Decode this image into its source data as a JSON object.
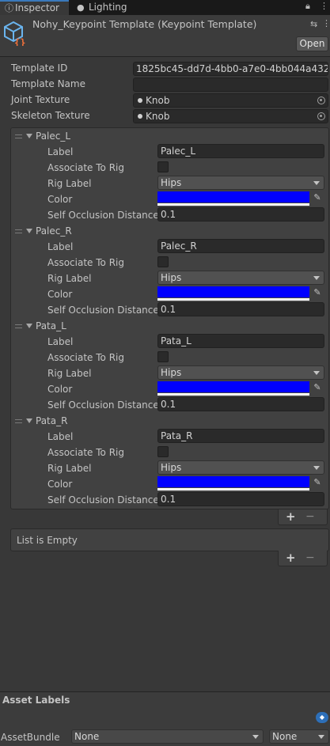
{
  "tabs": {
    "inspector": {
      "label": "Inspector",
      "icon": "info-icon"
    },
    "lighting": {
      "label": "Lighting",
      "icon": "lightbulb-icon"
    }
  },
  "header": {
    "title": "Nohy_Keypoint Template (Keypoint Template)",
    "icon": "scriptable-object-icon",
    "open_label": "Open"
  },
  "fields": {
    "template_id": {
      "label": "Template ID",
      "value": "1825bc45-dd7d-4bb0-a7e0-4bb044a432"
    },
    "template_name": {
      "label": "Template Name",
      "value": ""
    },
    "joint_texture": {
      "label": "Joint Texture",
      "value": "Knob"
    },
    "skeleton_texture": {
      "label": "Skeleton Texture",
      "value": "Knob"
    }
  },
  "keypoints": [
    {
      "name": "Palec_L",
      "label_text": "Label",
      "label_value": "Palec_L",
      "associate_text": "Associate To Rig",
      "rig_text": "Rig Label",
      "rig_value": "Hips",
      "color_text": "Color",
      "color_value": "#0000ff",
      "occlusion_text": "Self Occlusion Distance",
      "occlusion_value": "0.1"
    },
    {
      "name": "Palec_R",
      "label_text": "Label",
      "label_value": "Palec_R",
      "associate_text": "Associate To Rig",
      "rig_text": "Rig Label",
      "rig_value": "Hips",
      "color_text": "Color",
      "color_value": "#0000ff",
      "occlusion_text": "Self Occlusion Distance",
      "occlusion_value": "0.1"
    },
    {
      "name": "Pata_L",
      "label_text": "Label",
      "label_value": "Pata_L",
      "associate_text": "Associate To Rig",
      "rig_text": "Rig Label",
      "rig_value": "Hips",
      "color_text": "Color",
      "color_value": "#0000ff",
      "occlusion_text": "Self Occlusion Distance",
      "occlusion_value": "0.1"
    },
    {
      "name": "Pata_R",
      "label_text": "Label",
      "label_value": "Pata_R",
      "associate_text": "Associate To Rig",
      "rig_text": "Rig Label",
      "rig_value": "Hips",
      "color_text": "Color",
      "color_value": "#0000ff",
      "occlusion_text": "Self Occlusion Distance",
      "occlusion_value": "0.1"
    }
  ],
  "list_controls": {
    "add": "+",
    "remove": "−"
  },
  "empty_list": {
    "text": "List is Empty"
  },
  "asset_labels": {
    "title": "Asset Labels"
  },
  "asset_bundle": {
    "label": "AssetBundle",
    "bundle_value": "None",
    "variant_value": "None"
  },
  "colors": {
    "accent": "#3a79bb",
    "panel": "#383838",
    "field": "#2a2a2a",
    "swatch": "#0000ff"
  }
}
